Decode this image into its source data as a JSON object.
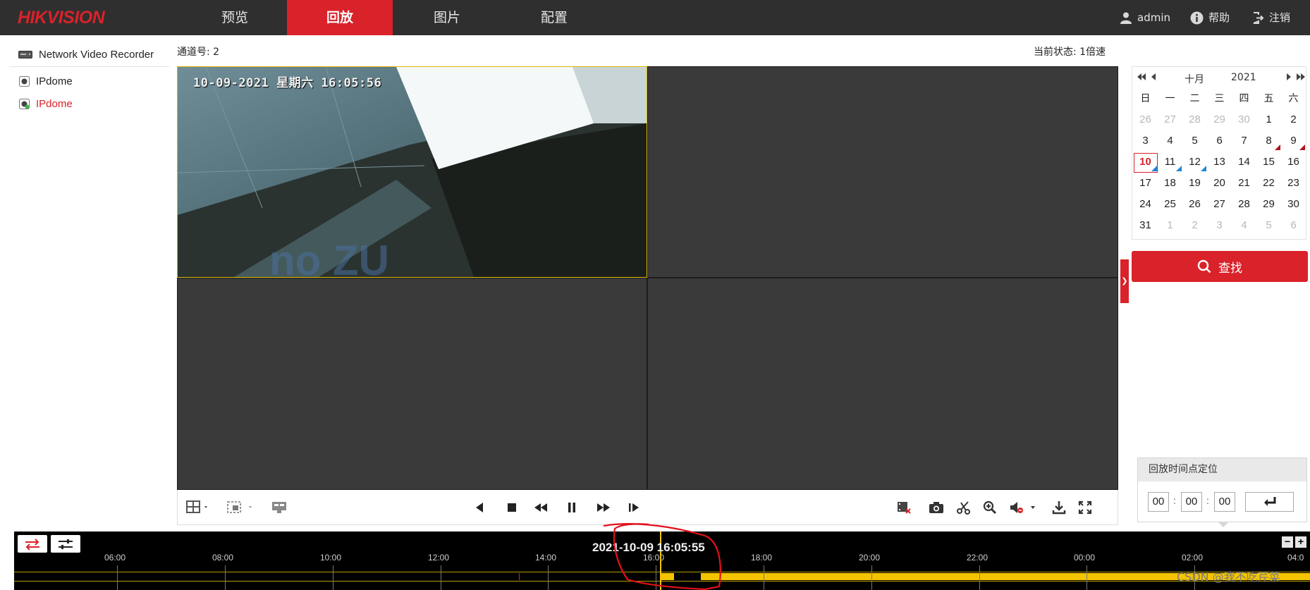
{
  "app": {
    "brand": "HIKVISION"
  },
  "nav": {
    "tabs": [
      {
        "label": "预览"
      },
      {
        "label": "回放",
        "active": true
      },
      {
        "label": "图片"
      },
      {
        "label": "配置"
      }
    ],
    "user": "admin",
    "help": "帮助",
    "logout": "注销"
  },
  "sidebar": {
    "device": "Network Video Recorder",
    "channels": [
      {
        "label": "IPdome",
        "active": false
      },
      {
        "label": "IPdome",
        "active": true
      }
    ]
  },
  "player": {
    "channel_label": "通道号: 2",
    "status_label": "当前状态: 1倍速",
    "osd_text": "10-09-2021 星期六 16:05:56"
  },
  "calendar": {
    "month": "十月",
    "year": "2021",
    "weekdays": [
      "日",
      "一",
      "二",
      "三",
      "四",
      "五",
      "六"
    ],
    "days": [
      {
        "d": "26",
        "muted": true
      },
      {
        "d": "27",
        "muted": true
      },
      {
        "d": "28",
        "muted": true
      },
      {
        "d": "29",
        "muted": true
      },
      {
        "d": "30",
        "muted": true
      },
      {
        "d": "1"
      },
      {
        "d": "2"
      },
      {
        "d": "3"
      },
      {
        "d": "4"
      },
      {
        "d": "5"
      },
      {
        "d": "6"
      },
      {
        "d": "7"
      },
      {
        "d": "8",
        "mark": "red"
      },
      {
        "d": "9",
        "mark": "red"
      },
      {
        "d": "10",
        "today": true,
        "mark": "blue"
      },
      {
        "d": "11",
        "mark": "blue"
      },
      {
        "d": "12",
        "mark": "blue"
      },
      {
        "d": "13"
      },
      {
        "d": "14"
      },
      {
        "d": "15"
      },
      {
        "d": "16"
      },
      {
        "d": "17"
      },
      {
        "d": "18"
      },
      {
        "d": "19"
      },
      {
        "d": "20"
      },
      {
        "d": "21"
      },
      {
        "d": "22"
      },
      {
        "d": "23"
      },
      {
        "d": "24"
      },
      {
        "d": "25"
      },
      {
        "d": "26"
      },
      {
        "d": "27"
      },
      {
        "d": "28"
      },
      {
        "d": "29"
      },
      {
        "d": "30"
      },
      {
        "d": "31"
      },
      {
        "d": "1",
        "muted": true
      },
      {
        "d": "2",
        "muted": true
      },
      {
        "d": "3",
        "muted": true
      },
      {
        "d": "4",
        "muted": true
      },
      {
        "d": "5",
        "muted": true
      },
      {
        "d": "6",
        "muted": true
      }
    ],
    "search_label": "查找"
  },
  "locate": {
    "title": "回放时间点定位",
    "hour": "00",
    "minute": "00",
    "second": "00"
  },
  "timeline": {
    "current_time": "2021-10-09 16:05:55",
    "ticks": [
      "06:00",
      "08:00",
      "10:00",
      "12:00",
      "14:00",
      "16:00",
      "18:00",
      "20:00",
      "22:00",
      "00:00",
      "02:00",
      "04:0"
    ]
  },
  "watermark": "CSDN @我不吃芹菜",
  "colors": {
    "brand_red": "#d9222a",
    "header_bg": "#2f2f2f",
    "record_yellow": "#f5c400",
    "calendar_mark_red": "#b0131b",
    "calendar_mark_blue": "#1f86d6"
  }
}
